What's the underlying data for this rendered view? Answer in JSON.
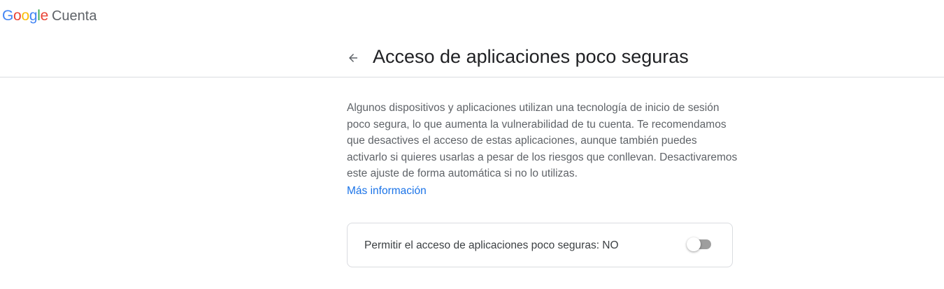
{
  "brand": {
    "google_letters": [
      {
        "char": "G",
        "color": "#4285F4"
      },
      {
        "char": "o",
        "color": "#EA4335"
      },
      {
        "char": "o",
        "color": "#FBBC05"
      },
      {
        "char": "g",
        "color": "#4285F4"
      },
      {
        "char": "l",
        "color": "#34A853"
      },
      {
        "char": "e",
        "color": "#EA4335"
      }
    ],
    "product": "Cuenta"
  },
  "header": {
    "back_icon": "arrow-back-icon",
    "title": "Acceso de aplicaciones poco seguras"
  },
  "description": {
    "text": "Algunos dispositivos y aplicaciones utilizan una tecnología de inicio de sesión poco segura, lo que aumenta la vulnerabilidad de tu cuenta. Te recomendamos que desactives el acceso de estas aplicaciones, aunque también puedes activarlo si quieres usarlas a pesar de los riesgos que conllevan. Desactivaremos este ajuste de forma automática si no lo utilizas.",
    "link": "Más información"
  },
  "setting": {
    "label": "Permitir el acceso de aplicaciones poco seguras: NO",
    "enabled": false
  },
  "colors": {
    "link": "#1a73e8",
    "toggle_off_track": "#9e9e9e",
    "divider": "#dadce0"
  }
}
